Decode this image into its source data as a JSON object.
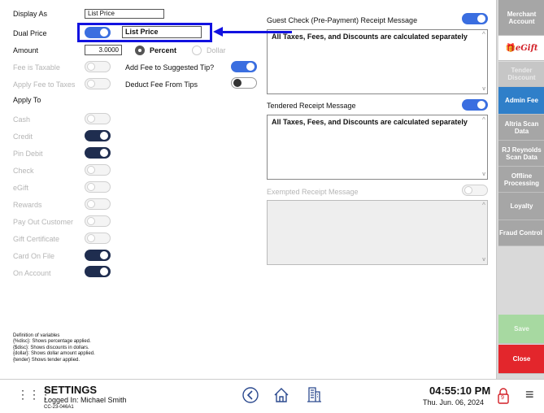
{
  "form": {
    "display_as_label": "Display As",
    "display_as_value": "List Price",
    "dual_price_label": "Dual Price",
    "dual_price_value": "List Price",
    "amount_label": "Amount",
    "amount_value": "3.0000",
    "percent_label": "Percent",
    "dollar_label": "Dollar",
    "fee_taxable_label": "Fee is Taxable",
    "apply_fee_taxes_label": "Apply Fee to Taxes",
    "add_fee_tip_label": "Add Fee to Suggested Tip?",
    "deduct_fee_tips_label": "Deduct Fee From Tips",
    "apply_to_label": "Apply To"
  },
  "apply_to": [
    {
      "label": "Cash",
      "state": "dis"
    },
    {
      "label": "Credit",
      "state": "on-navy"
    },
    {
      "label": "Pin Debit",
      "state": "on-navy"
    },
    {
      "label": "Check",
      "state": "dis"
    },
    {
      "label": "eGift",
      "state": "dis"
    },
    {
      "label": "Rewards",
      "state": "dis"
    },
    {
      "label": "Pay Out Customer",
      "state": "dis"
    },
    {
      "label": "Gift Certificate",
      "state": "dis"
    },
    {
      "label": "Card On File",
      "state": "on-navy"
    },
    {
      "label": "On Account",
      "state": "on-navy"
    }
  ],
  "definitions": {
    "title": "Definition of variables",
    "l1": "{%disc}: Shows percentage applied.",
    "l2": "{$disc}: Shows discounts in dollars.",
    "l3": "{dollar}: Shows dollar amount applied.",
    "l4": "{tender} Shows tender applied."
  },
  "receipts": {
    "guest_label": "Guest Check (Pre-Payment) Receipt Message",
    "guest_text": "All Taxes, Fees, and Discounts are calculated separately",
    "tendered_label": "Tendered Receipt Message",
    "tendered_text": "All Taxes, Fees, and Discounts are calculated separately",
    "exempted_label": "Exempted Receipt Message"
  },
  "side": {
    "merchant": "Merchant Account",
    "egift": "eGift",
    "tender_discount": "Tender Discount",
    "admin_fee": "Admin Fee",
    "altria": "Altria Scan Data",
    "rj": "RJ Reynolds Scan Data",
    "offline": "Offline Processing",
    "loyalty": "Loyalty",
    "fraud": "Fraud Control",
    "save": "Save",
    "close": "Close"
  },
  "footer": {
    "title": "SETTINGS",
    "logged_in": "Logged In:  Michael Smith",
    "device": "CC-23-046A1",
    "time": "04:55:10 PM",
    "date": "Thu. Jun. 06, 2024",
    "lock_badge": "9"
  },
  "colors": {
    "toggle_on": "#3a6ee0",
    "toggle_navy": "#1f2d4f",
    "highlight": "#1212e0",
    "admin_fee_active": "#2f7fc9",
    "close_button": "#e3262c",
    "save_button": "#a7d9a1"
  }
}
